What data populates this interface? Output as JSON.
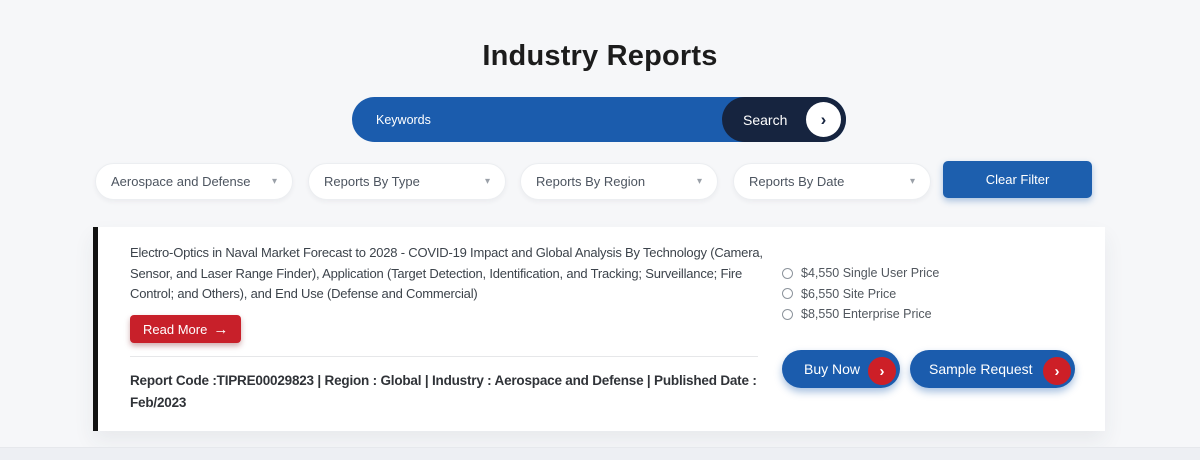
{
  "page": {
    "title": "Industry Reports"
  },
  "search": {
    "placeholder": "Keywords",
    "button_label": "Search"
  },
  "filters": {
    "industry": "Aerospace and Defense",
    "type": "Reports By Type",
    "region": "Reports By Region",
    "date": "Reports By Date",
    "clear_label": "Clear Filter"
  },
  "report": {
    "title": "Electro-Optics in Naval Market Forecast to 2028 - COVID-19 Impact and Global Analysis By Technology (Camera, Sensor, and Laser Range Finder), Application (Target Detection, Identification, and Tracking; Surveillance; Fire Control; and Others), and End Use (Defense and Commercial)",
    "read_more_label": "Read More",
    "meta": "Report Code :TIPRE00029823 | Region : Global | Industry : Aerospace and Defense | Published Date : Feb/2023",
    "prices": [
      {
        "label": "$4,550 Single User Price",
        "selected": false
      },
      {
        "label": "$6,550 Site Price",
        "selected": false
      },
      {
        "label": "$8,550 Enterprise Price",
        "selected": false
      }
    ],
    "buy_label": "Buy Now",
    "sample_label": "Sample Request"
  },
  "icons": {
    "search_arrow": "chevron-right",
    "dropdown_caret": "chevron-down",
    "read_more_arrow": "arrow-right",
    "action_arrow": "chevron-right"
  },
  "colors": {
    "primary_blue": "#1b5cad",
    "dark_navy": "#16243f",
    "accent_red": "#c8202a",
    "page_background": "#f6f7f9",
    "card_background": "#ffffff",
    "card_left_bar": "#121212"
  }
}
